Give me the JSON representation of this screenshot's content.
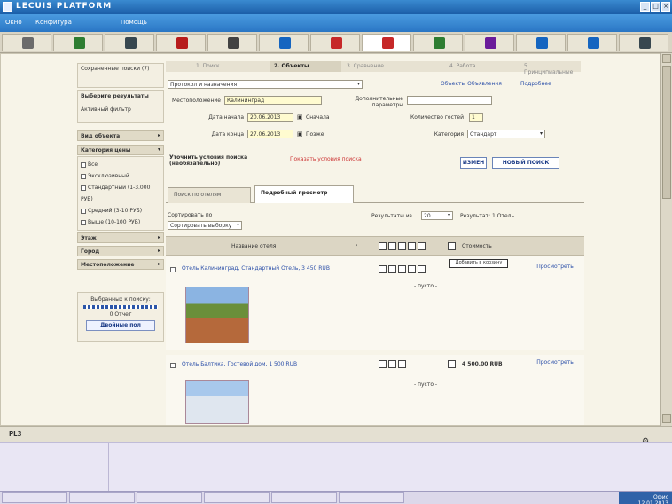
{
  "window": {
    "title": "LECUIS PLATFORM",
    "min": "_",
    "max": "□",
    "close": "×"
  },
  "menu": [
    "Окно",
    "Конфигура",
    "Помощь"
  ],
  "toolbar": {
    "icons": [
      "toolbar-icon-1",
      "toolbar-icon-2",
      "toolbar-icon-3",
      "toolbar-icon-4",
      "toolbar-icon-5",
      "toolbar-icon-6",
      "toolbar-icon-7",
      "toolbar-icon-8",
      "toolbar-icon-9",
      "toolbar-icon-10",
      "toolbar-icon-11",
      "toolbar-icon-12",
      "toolbar-icon-13"
    ],
    "colors": [
      "#6b6b6b",
      "#2e7d32",
      "#37474f",
      "#b71c1c",
      "#424242",
      "#1565c0",
      "#c62828",
      "#c62828",
      "#2e7d32",
      "#6a1b9a",
      "#1565c0",
      "#1565c0",
      "#37474f"
    ],
    "selected": 7
  },
  "left": {
    "saved_block": "Сохраненные поиски (7)",
    "choose_title": "Выберите результаты",
    "choose_sub": "Активный фильтр",
    "sections": {
      "type": "Вид объекта",
      "category": "Категория цены",
      "city": "Город",
      "location": "Местоположение",
      "floor": "Этаж"
    },
    "category_options": [
      "Все",
      "Эксклюзивный",
      "Стандартный (1-3.000 РУБ)",
      "Средний (3-10 РУБ)",
      "Выше (10-100 РУБ)"
    ],
    "basket": {
      "title": "Выбранных к поиску:",
      "count": "0 Отчет",
      "button": "Двойные пол"
    }
  },
  "main": {
    "steps": [
      "1. Поиск",
      "2. Объекты",
      "3. Сравнение",
      "4. Работа",
      "5. Принципиальные"
    ],
    "search_select": "Протокол и назначения",
    "links": {
      "left": "Объекты Объявления",
      "right": "Подробнее"
    },
    "fields": {
      "location_label": "Местоположение",
      "location_value": "Калининград",
      "date_from_label": "Дата начала",
      "date_from": "20.06.2013",
      "date_to_label": "Дата конца",
      "date_to": "27.06.2013",
      "check1": "Сначала",
      "check2": "Позже",
      "extra_label": "Дополнительные параметры",
      "guests_label": "Количество гостей",
      "guests_value": "1",
      "type_label": "Категория",
      "type_value": "Стандарт",
      "hint": "Уточнить условия поиска (необязательно)",
      "hint2": "Показать условия поиска"
    },
    "buttons": {
      "reset": "ИЗМЕН",
      "search": "НОВЫЙ ПОИСК"
    },
    "tabs": [
      "Поиск по отелям",
      "Подробный просмотр"
    ],
    "toolbar2": {
      "sort_label": "Сортировать по",
      "sort_value": "Сортировать выборку",
      "page_label": "Результаты из",
      "page_value": "20",
      "found": "Результат: 1 Отель"
    },
    "table": {
      "col_name": "Название отеля",
      "col_price": "Стоимость"
    },
    "results": [
      {
        "name": "Отель Калининград, Стандартный Отель, 3 450 RUB",
        "price": "",
        "link": "Просмотреть",
        "tooltip": "Добавить в корзину",
        "more": "- пусто -"
      },
      {
        "name": "Отель Балтика, Гостевой дом, 1 500 RUB",
        "price": "4 500,00 RUB",
        "link": "Просмотреть",
        "tooltip": "",
        "more": "- пусто -"
      }
    ]
  },
  "status": {
    "label": "PL3"
  },
  "taskbar": {
    "items": [
      "",
      "",
      "",
      "",
      "",
      ""
    ],
    "right": "Офис 12.01.2013"
  }
}
